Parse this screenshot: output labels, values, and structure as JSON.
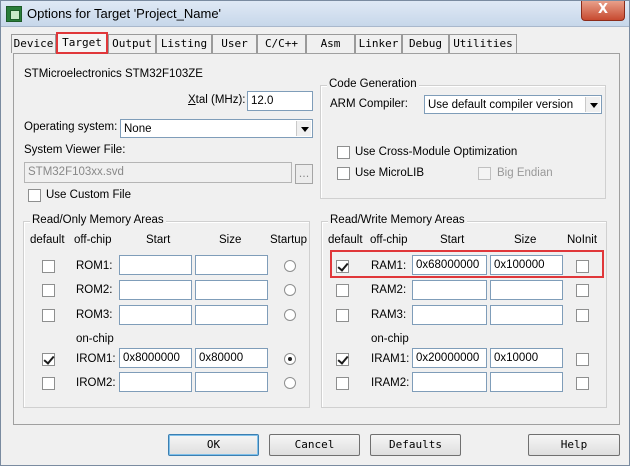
{
  "window": {
    "title": "Options for Target 'Project_Name'",
    "close_symbol": "X"
  },
  "tabs": [
    {
      "label": "Device"
    },
    {
      "label": "Target"
    },
    {
      "label": "Output"
    },
    {
      "label": "Listing"
    },
    {
      "label": "User"
    },
    {
      "label": "C/C++"
    },
    {
      "label": "Asm"
    },
    {
      "label": "Linker"
    },
    {
      "label": "Debug"
    },
    {
      "label": "Utilities"
    }
  ],
  "active_tab": "Target",
  "device_name": "STMicroelectronics STM32F103ZE",
  "xtal": {
    "label_pre": "X",
    "label_post": "tal (MHz):",
    "value": "12.0"
  },
  "operating_system": {
    "label": "Operating system:",
    "value": "None"
  },
  "system_viewer": {
    "label": "System Viewer File:",
    "value": "STM32F103xx.svd",
    "browse": "..."
  },
  "use_custom_file": {
    "label": "Use Custom File",
    "checked": false
  },
  "code_generation": {
    "title": "Code Generation",
    "arm_compiler_label": "ARM Compiler:",
    "arm_compiler_value": "Use default compiler version",
    "cross_module": {
      "label": "Use Cross-Module Optimization",
      "checked": false
    },
    "microlib": {
      "label": "Use MicroLIB",
      "checked": false
    },
    "big_endian": {
      "label": "Big Endian",
      "checked": false
    }
  },
  "readonly_memory": {
    "title": "Read/Only Memory Areas",
    "headers": {
      "default": "default",
      "offchip": "off-chip",
      "start": "Start",
      "size": "Size",
      "startup": "Startup"
    },
    "onchip_label": "on-chip",
    "rows": [
      {
        "label": "ROM1:",
        "default": false,
        "start": "",
        "size": "",
        "startup": false
      },
      {
        "label": "ROM2:",
        "default": false,
        "start": "",
        "size": "",
        "startup": false
      },
      {
        "label": "ROM3:",
        "default": false,
        "start": "",
        "size": "",
        "startup": false
      },
      {
        "label": "IROM1:",
        "default": true,
        "start": "0x8000000",
        "size": "0x80000",
        "startup": true
      },
      {
        "label": "IROM2:",
        "default": false,
        "start": "",
        "size": "",
        "startup": false
      }
    ]
  },
  "readwrite_memory": {
    "title": "Read/Write Memory Areas",
    "headers": {
      "default": "default",
      "offchip": "off-chip",
      "start": "Start",
      "size": "Size",
      "noinit": "NoInit"
    },
    "onchip_label": "on-chip",
    "rows": [
      {
        "label": "RAM1:",
        "default": true,
        "start": "0x68000000",
        "size": "0x100000",
        "noinit": false
      },
      {
        "label": "RAM2:",
        "default": false,
        "start": "",
        "size": "",
        "noinit": false
      },
      {
        "label": "RAM3:",
        "default": false,
        "start": "",
        "size": "",
        "noinit": false
      },
      {
        "label": "IRAM1:",
        "default": true,
        "start": "0x20000000",
        "size": "0x10000",
        "noinit": false
      },
      {
        "label": "IRAM2:",
        "default": false,
        "start": "",
        "size": "",
        "noinit": false
      }
    ]
  },
  "buttons": {
    "ok": "OK",
    "cancel": "Cancel",
    "defaults": "Defaults",
    "help": "Help"
  },
  "colors": {
    "highlight": "#e0373a",
    "title_gradient_top": "#dfe9f5",
    "close_button": "#c74a30"
  }
}
